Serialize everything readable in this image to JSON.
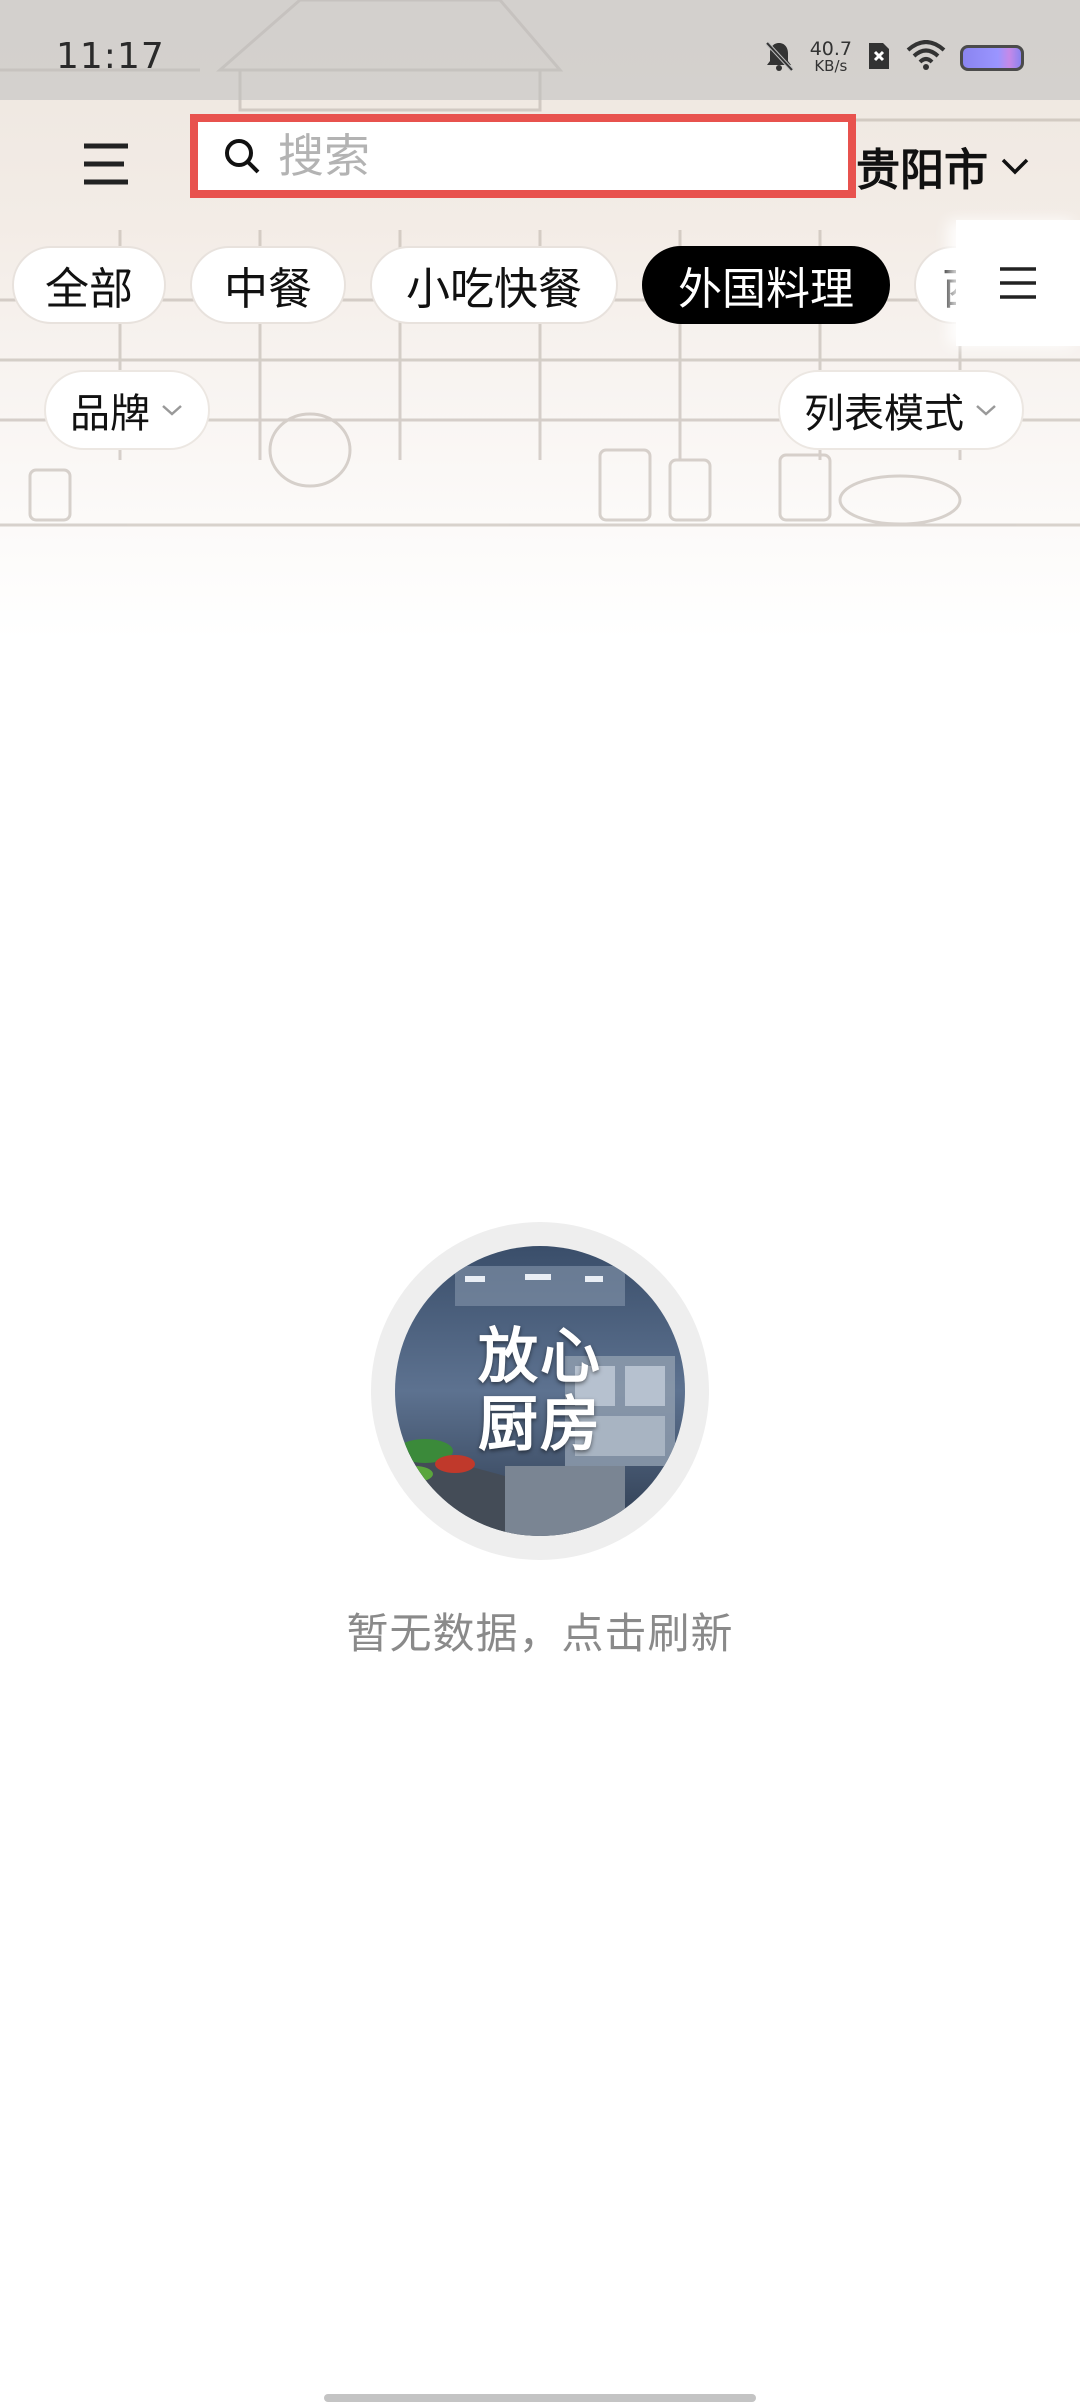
{
  "status_bar": {
    "time": "11:17",
    "net_speed_value": "40.7",
    "net_speed_unit": "KB/s",
    "icons": [
      "bell-muted-icon",
      "sim-x-icon",
      "wifi-icon",
      "battery-icon"
    ]
  },
  "top_bar": {
    "menu_icon": "hamburger-menu-icon",
    "search_placeholder": "搜索",
    "search_value": "",
    "city": "贵阳市"
  },
  "categories": {
    "items": [
      "全部",
      "中餐",
      "小吃快餐",
      "外国料理",
      "西"
    ],
    "active": "外国料理",
    "more_icon": "list-menu-icon"
  },
  "filters": {
    "brand": "品牌",
    "view_mode": "列表模式"
  },
  "empty_state": {
    "logo_line1": "放心",
    "logo_line2": "厨房",
    "message": "暂无数据，点击刷新"
  },
  "colors": {
    "highlight_border": "#e8524e",
    "active_tab_bg": "#000000",
    "empty_text": "#8a8a8a"
  }
}
